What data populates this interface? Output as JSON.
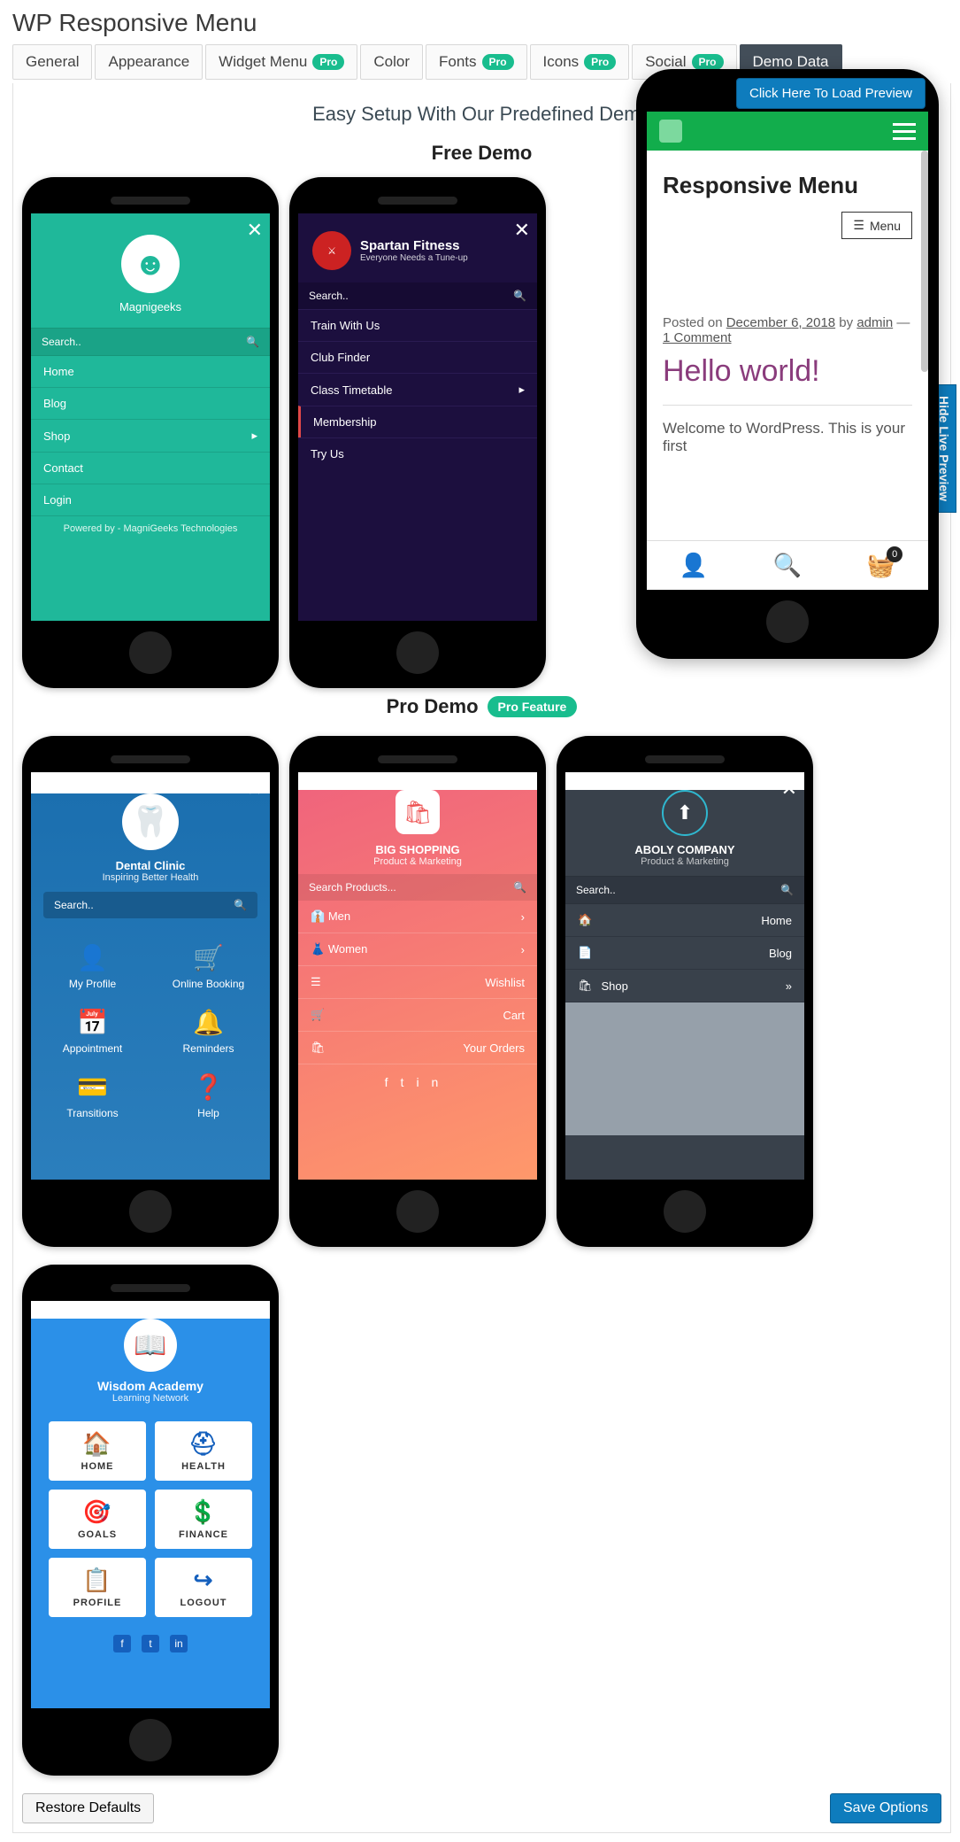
{
  "page_title": "WP Responsive Menu",
  "tabs": {
    "general": "General",
    "appearance": "Appearance",
    "widget": "Widget Menu",
    "color": "Color",
    "fonts": "Fonts",
    "icons": "Icons",
    "social": "Social",
    "demo": "Demo Data",
    "pro": "Pro"
  },
  "pro_pill": "Pro Feature",
  "load_preview": "Click Here To Load Preview",
  "hide_preview": "Hide Live Preview",
  "heading": "Easy Setup With Our Predefined Demo",
  "free_demo": "Free Demo",
  "pro_demo": "Pro Demo",
  "restore": "Restore Defaults",
  "save": "Save Options",
  "search": "Search..",
  "search_products": "Search Products...",
  "demo_mg": {
    "title": "Magnigeeks",
    "items": [
      "Home",
      "Blog",
      "Shop",
      "Contact",
      "Login"
    ],
    "footer": "Powered by - MagniGeeks Technologies"
  },
  "demo_sp": {
    "title": "Spartan Fitness",
    "sub": "Everyone Needs a Tune-up",
    "items": [
      "Train With Us",
      "Club Finder",
      "Class Timetable",
      "Membership",
      "Try Us"
    ]
  },
  "demo_dc": {
    "title": "Dental Clinic",
    "sub": "Inspiring Better Health",
    "cells": [
      "My Profile",
      "Online Booking",
      "Appointment",
      "Reminders",
      "Transitions",
      "Help"
    ]
  },
  "demo_bs": {
    "title": "BIG SHOPPING",
    "sub": "Product & Marketing",
    "items": [
      "Men",
      "Women",
      "Wishlist",
      "Cart",
      "Your Orders"
    ]
  },
  "demo_ab": {
    "title": "ABOLY COMPANY",
    "sub": "Product & Marketing",
    "items": [
      "Home",
      "Blog",
      "Shop"
    ]
  },
  "demo_wa": {
    "title": "Wisdom Academy",
    "sub": "Learning Network",
    "cards": [
      "HOME",
      "HEALTH",
      "GOALS",
      "FINANCE",
      "PROFILE",
      "LOGOUT"
    ]
  },
  "live": {
    "site": "Responsive Menu",
    "menu": "Menu",
    "posted": "Posted on ",
    "date": "December 6, 2018",
    "by": " by ",
    "author": "admin",
    "sep": " — ",
    "comments": "1 Comment",
    "post_title": "Hello world!",
    "excerpt": "Welcome to WordPress. This is your first",
    "cart_count": "0"
  }
}
